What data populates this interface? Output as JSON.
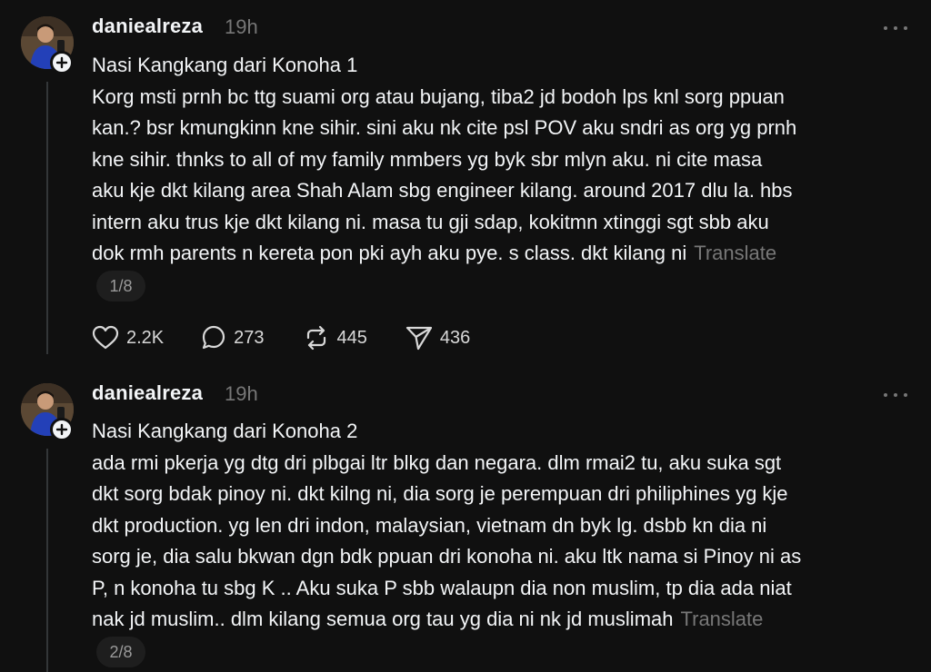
{
  "posts": [
    {
      "username": "daniealreza",
      "time": "19h",
      "title": "Nasi Kangkang dari Konoha 1",
      "lines": [
        "Korg msti prnh bc ttg suami org atau bujang, tiba2 jd bodoh lps knl sorg ppuan",
        "kan.? bsr kmungkinn kne sihir. sini aku nk cite psl POV aku sndri as org yg prnh",
        "kne sihir. thnks to all of my family mmbers yg byk sbr mlyn aku. ni cite masa",
        "aku kje dkt kilang area Shah Alam sbg engineer kilang. around 2017 dlu la. hbs",
        "intern aku trus kje dkt kilang ni. masa tu gji sdap, kokitmn xtinggi sgt sbb aku",
        "dok rmh parents n kereta pon pki ayh aku pye. s class. dkt kilang ni"
      ],
      "translate_label": "Translate",
      "page": "1/8",
      "likes": "2.2K",
      "replies": "273",
      "reposts": "445",
      "shares": "436"
    },
    {
      "username": "daniealreza",
      "time": "19h",
      "title": "Nasi Kangkang dari Konoha 2",
      "lines": [
        "ada rmi pkerja yg dtg dri plbgai ltr blkg dan negara. dlm rmai2 tu, aku suka sgt",
        "dkt sorg bdak pinoy ni. dkt kilng ni, dia sorg je perempuan dri philiphines yg kje",
        "dkt production. yg len dri indon, malaysian, vietnam dn byk lg. dsbb kn dia ni",
        "sorg je, dia salu bkwan dgn bdk ppuan dri konoha ni. aku ltk nama si Pinoy ni as",
        "P, n konoha tu sbg K .. Aku suka P sbb walaupn dia non muslim, tp dia ada niat",
        "nak jd muslim.. dlm kilang semua org tau yg dia ni nk jd muslimah"
      ],
      "translate_label": "Translate",
      "page": "2/8"
    }
  ],
  "icons": {
    "avatar": "profile-photo",
    "follow": "plus-icon",
    "more": "more-dots-icon",
    "like": "heart-icon",
    "reply": "comment-icon",
    "repost": "repost-icon",
    "share": "send-icon"
  },
  "colors": {
    "background": "#101010",
    "text_primary": "#f3f5f7",
    "text_secondary": "#777777"
  }
}
